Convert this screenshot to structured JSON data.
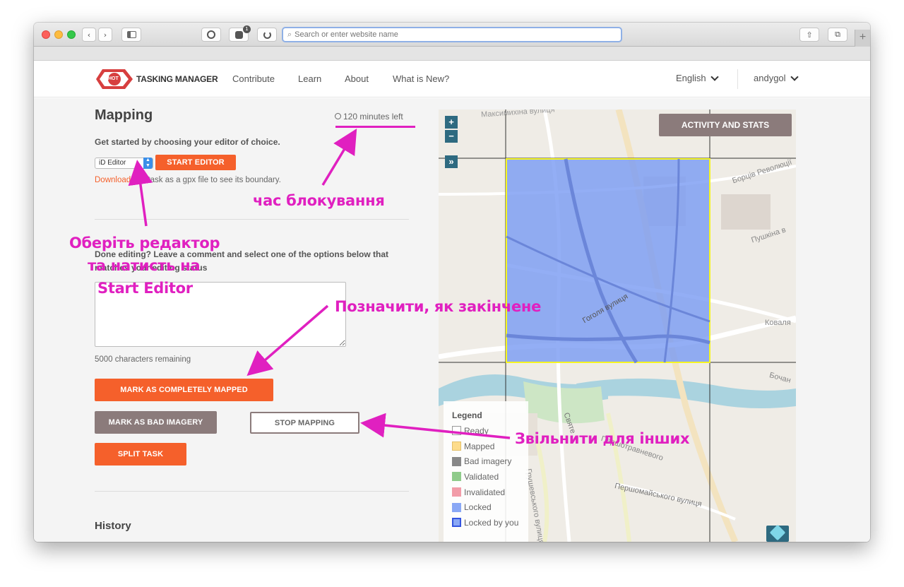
{
  "browser": {
    "address_placeholder": "Search or enter website name",
    "controls": [
      "back",
      "forward",
      "sidebar",
      "reader",
      "extension",
      "refresh"
    ],
    "extension_badge": "1"
  },
  "nav": {
    "logo_badge": "HOT",
    "logo_text": "TASKING MANAGER",
    "links": [
      "Contribute",
      "Learn",
      "About",
      "What is New?"
    ],
    "language": "English",
    "user": "andygol"
  },
  "panel": {
    "title": "Mapping",
    "time_left": "120 minutes left",
    "choose_editor": "Get started by choosing your editor of choice.",
    "editor_value": "iD Editor",
    "start_editor": "START EDITOR",
    "download_link": "Download",
    "download_rest": "this task as a gpx file to see its boundary.",
    "done_text": "Done editing? Leave a comment and select one of the options below that matches your editing status",
    "comment_placeholder": "",
    "chars_remaining": "5000 characters remaining",
    "mark_mapped": "MARK AS COMPLETELY MAPPED",
    "mark_bad": "MARK AS BAD IMAGERY",
    "stop_mapping": "STOP MAPPING",
    "split_task": "SPLIT TASK",
    "history": "History"
  },
  "map": {
    "zoom_in": "+",
    "zoom_out": "−",
    "expand": "»",
    "activity_button": "ACTIVITY AND STATS",
    "street_labels": [
      "Максимихіна вулиця",
      "Борців Революції",
      "Пушкіна в",
      "Гоголя вулиця",
      "Коваля",
      "Бочан",
      "Святе",
      "Першотравневого",
      "Першомайського вулиця",
      "Грушевського вулиця"
    ],
    "legend": {
      "title": "Legend",
      "items": [
        {
          "label": "Ready",
          "color": "#ffffff"
        },
        {
          "label": "Mapped",
          "color": "#fddc8b"
        },
        {
          "label": "Bad imagery",
          "color": "#888888"
        },
        {
          "label": "Validated",
          "color": "#8fcb8a"
        },
        {
          "label": "Invalidated",
          "color": "#f29ca8"
        },
        {
          "label": "Locked",
          "color": "#8aa8f5"
        },
        {
          "label": "Locked by you",
          "color": "#4a6ff0"
        }
      ]
    }
  },
  "annotations": {
    "lock_time": "час блокування",
    "choose_editor_1": "Оберіть редактор",
    "choose_editor_2": "та натисть на",
    "choose_editor_3": "Start Editor",
    "mark_done": "Позначити, як закінчене",
    "release": "Звільнити для інших",
    "color": "#e020c0"
  }
}
